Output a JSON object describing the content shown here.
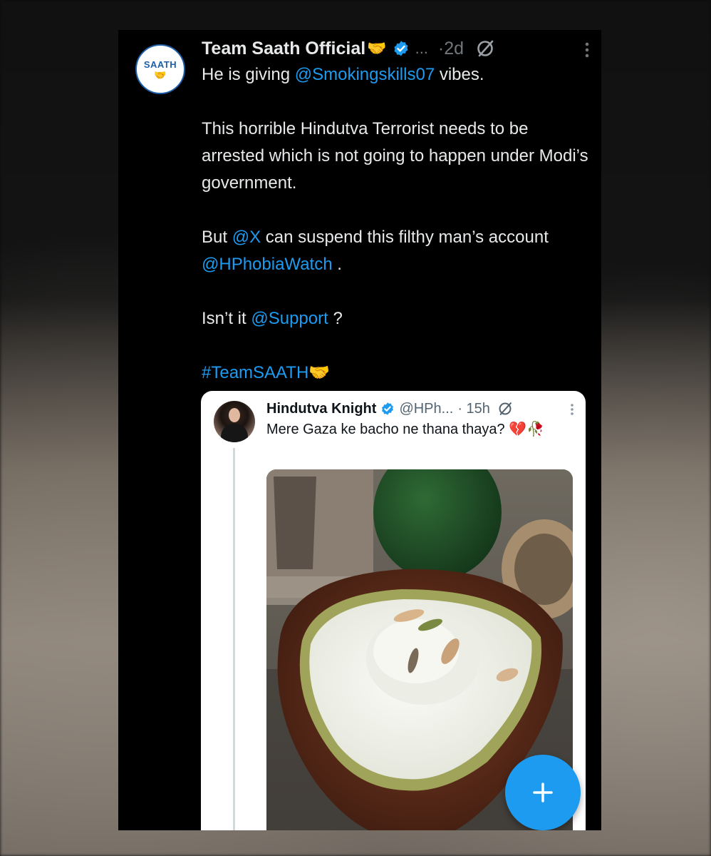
{
  "tweet": {
    "avatar_text": "SAATH",
    "display_name": "Team Saath Official",
    "name_emoji": "🤝",
    "handle_truncated": "...",
    "time": "·2d",
    "line1_pre": "He is giving ",
    "line1_mention": "@Smokingskills07",
    "line1_post": " vibes.",
    "para2": "This horrible Hindutva Terrorist needs to be arrested which is not going to happen under Modi’s government.",
    "para3_pre": "But ",
    "para3_mention1": "@X",
    "para3_mid": " can suspend this filthy man’s account ",
    "para3_mention2": "@HPhobiaWatch",
    "para3_post": " .",
    "para4_pre": "Isn’t it ",
    "para4_mention": "@Support",
    "para4_post": " ?",
    "hashtag": "#TeamSAATH",
    "hashtag_emoji": "🤝"
  },
  "quote": {
    "display_name": "Hindutva Knight",
    "handle": "@HPh...",
    "time": "· 15h",
    "text": "Mere Gaza ke bacho ne thana thaya? 💔🥀"
  },
  "icons": {
    "verified": "verified-badge-icon",
    "grok": "grok-icon",
    "more": "more-vertical-icon",
    "compose": "plus-icon"
  },
  "colors": {
    "link": "#1d9bf0",
    "verified": "#1d9bf0",
    "background": "#000000",
    "text": "#e7e9ea",
    "fab": "#1d9bf0"
  }
}
